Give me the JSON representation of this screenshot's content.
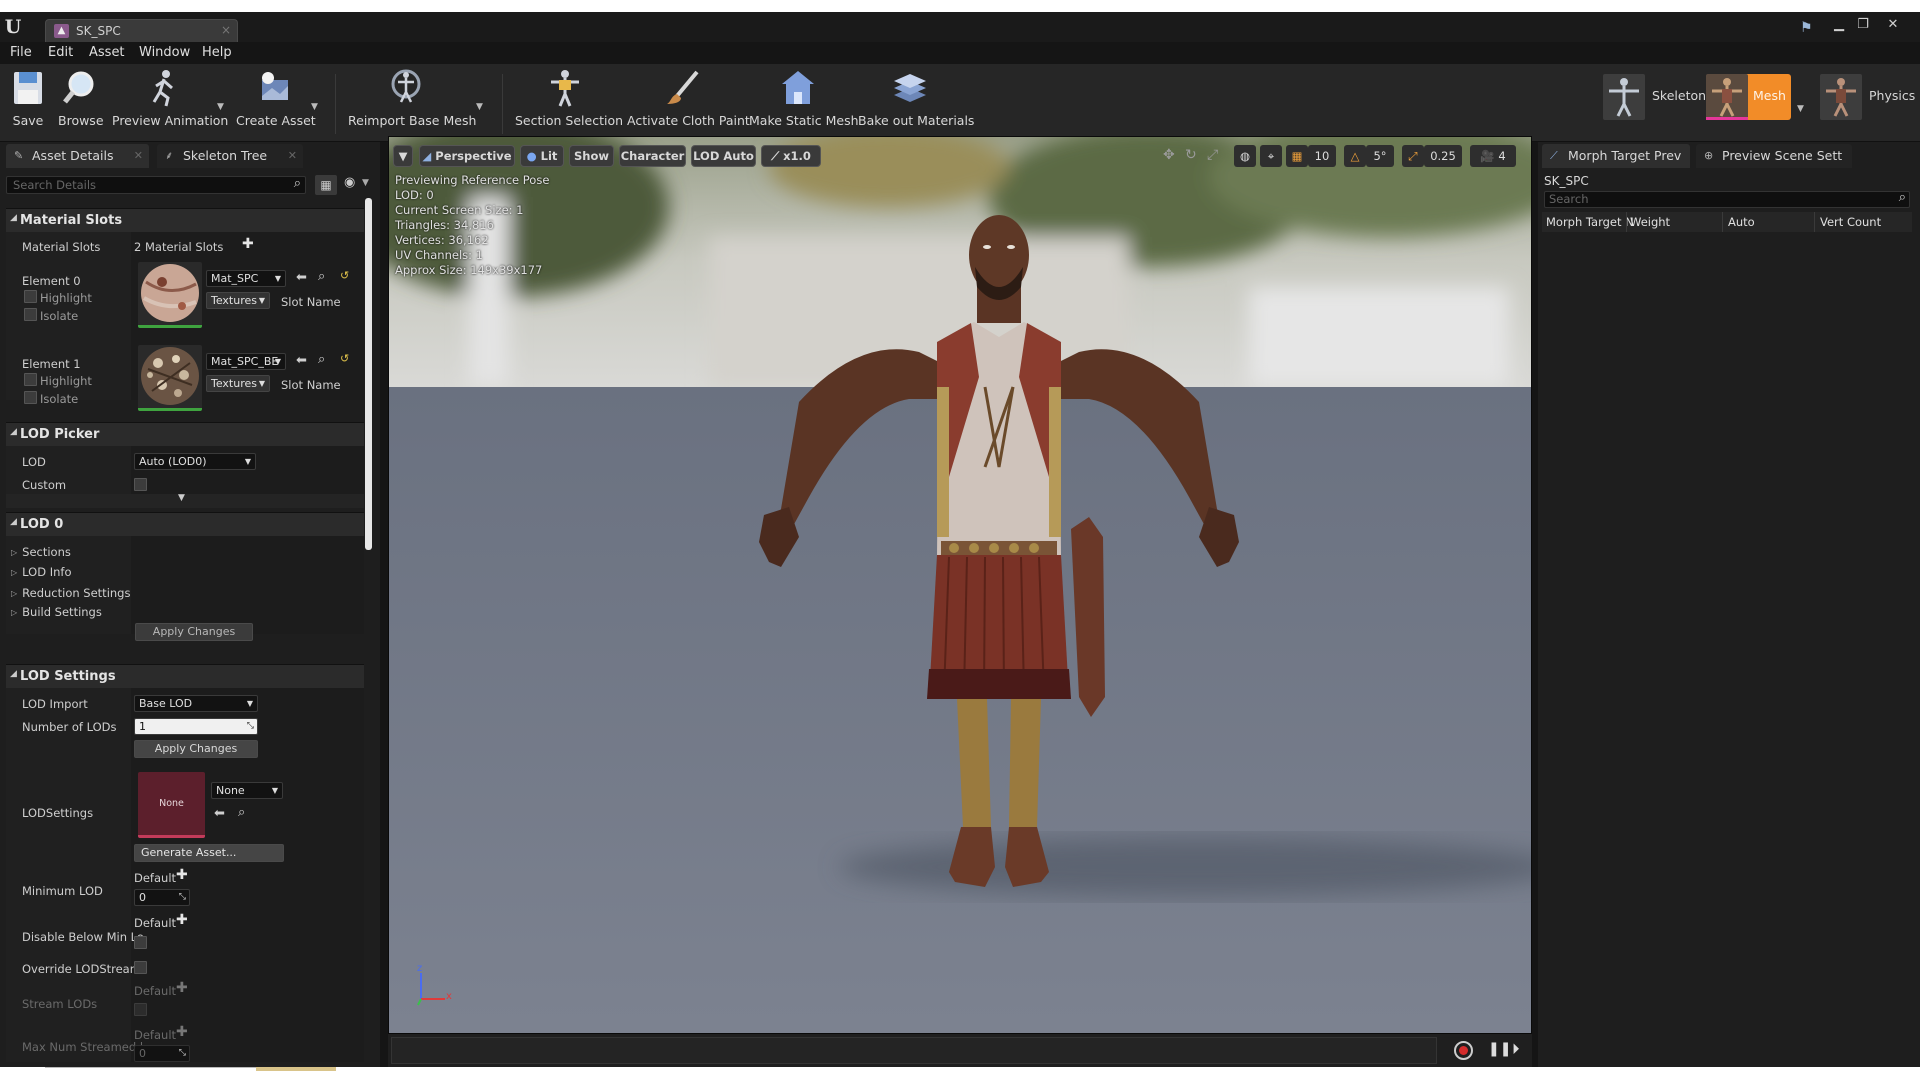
{
  "window": {
    "tab_title": "SK_SPC",
    "tab_close": "×",
    "controls": {
      "minimize": "▁",
      "restore": "❐",
      "close": "✕"
    }
  },
  "menu": [
    "File",
    "Edit",
    "Asset",
    "Window",
    "Help"
  ],
  "toolbar": {
    "buttons": [
      "Save",
      "Browse",
      "Preview Animation",
      "Create Asset",
      "Reimport Base Mesh",
      "Section Selection",
      "Activate Cloth Paint",
      "Make Static Mesh",
      "Bake out Materials"
    ],
    "modes": [
      "Skeleton",
      "Mesh",
      "Physics"
    ],
    "active_mode_color": "#f28c28"
  },
  "left_panel": {
    "tabs": [
      "Asset Details",
      "Skeleton Tree"
    ],
    "search_placeholder": "Search Details",
    "material_slots": {
      "header": "Material Slots",
      "label": "Material Slots",
      "count_text": "2 Material Slots",
      "elements": [
        {
          "name": "Element 0",
          "highlight": "Highlight",
          "isolate": "Isolate",
          "material": "Mat_SPC",
          "textures": "Textures",
          "slot_name": "Slot Name"
        },
        {
          "name": "Element 1",
          "highlight": "Highlight",
          "isolate": "Isolate",
          "material": "Mat_SPC_BE",
          "textures": "Textures",
          "slot_name": "Slot Name"
        }
      ]
    },
    "lod_picker": {
      "header": "LOD Picker",
      "lod_label": "LOD",
      "lod_value": "Auto (LOD0)",
      "custom_label": "Custom"
    },
    "lod0": {
      "header": "LOD 0",
      "subcategories": [
        "Sections",
        "LOD Info",
        "Reduction Settings",
        "Build Settings"
      ],
      "apply_button": "Apply Changes"
    },
    "lod_settings": {
      "header": "LOD Settings",
      "lod_import_label": "LOD Import",
      "lod_import_value": "Base LOD",
      "num_lods_label": "Number of LODs",
      "num_lods_value": "1",
      "apply_button": "Apply Changes",
      "lodsettings_label": "LODSettings",
      "asset_thumb_text": "None",
      "asset_value": "None",
      "generate_button": "Generate Asset...",
      "min_lod_label": "Minimum LOD",
      "default_text": "Default",
      "min_lod_value": "0",
      "disable_below_label": "Disable Below Min Lo",
      "override_stream_label": "Override LODStreami",
      "stream_lods_label": "Stream LODs",
      "max_streamed_label": "Max Num Streamed l",
      "max_streamed_value": "0"
    }
  },
  "viewport": {
    "buttons": [
      "Perspective",
      "Lit",
      "Show",
      "Character",
      "LOD Auto",
      "x1.0"
    ],
    "grid_snap": "10",
    "rot_snap": "5°",
    "scale_snap": "0.25",
    "cam_speed": "4",
    "stats": [
      "Previewing Reference Pose",
      "LOD: 0",
      "Current Screen Size: 1",
      "Triangles: 34,816",
      "Vertices: 36,162",
      "UV Channels: 1",
      "Approx Size: 149x39x177"
    ],
    "axis": {
      "z": "z",
      "x": "x"
    }
  },
  "right_panel": {
    "tabs": [
      "Morph Target Prev",
      "Preview Scene Sett"
    ],
    "mesh_name": "SK_SPC",
    "search_placeholder": "Search",
    "columns": [
      "Morph Target N",
      "Weight",
      "Auto",
      "Vert Count"
    ]
  }
}
